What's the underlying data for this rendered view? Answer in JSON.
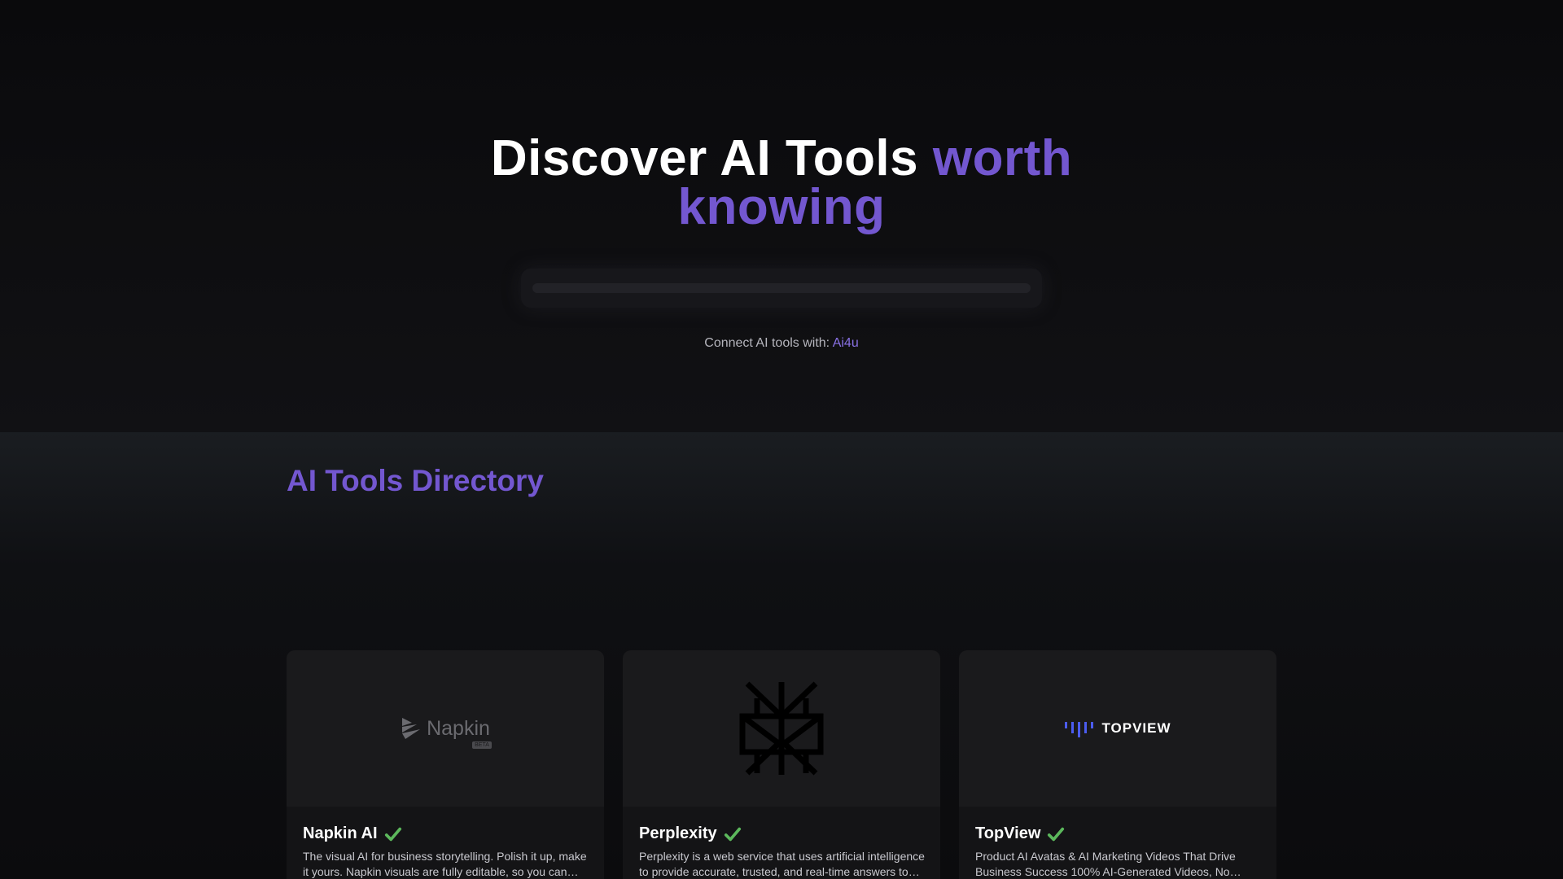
{
  "hero": {
    "title_main": "Discover AI Tools",
    "title_accent_1": "worth",
    "title_accent_2": "knowing",
    "connect_prefix": "Connect AI tools with: ",
    "connect_link": "Ai4u"
  },
  "directory": {
    "title": "AI Tools Directory"
  },
  "cards": [
    {
      "name": "Napkin AI",
      "logo_text": "Napkin",
      "logo_tag": "BETA",
      "description": "The visual AI for business storytelling. Polish it up, make it yours. Napkin visuals are fully editable, so you can customize colors, icons, fonts, and layout."
    },
    {
      "name": "Perplexity",
      "description": "Perplexity is a web service that uses artificial intelligence to provide accurate, trusted, and real-time answers to any question."
    },
    {
      "name": "TopView",
      "logo_text": "TOPVIEW",
      "description": "Product AI Avatas & AI Marketing Videos That Drive Business Success 100% AI-Generated Videos, No Filming or Editing Required."
    }
  ],
  "colors": {
    "accent": "#7357d0",
    "verified": "#5cb85c",
    "topview_brand": "#4b5cf0"
  },
  "icons": {
    "verified": "check-mark-button-icon"
  }
}
